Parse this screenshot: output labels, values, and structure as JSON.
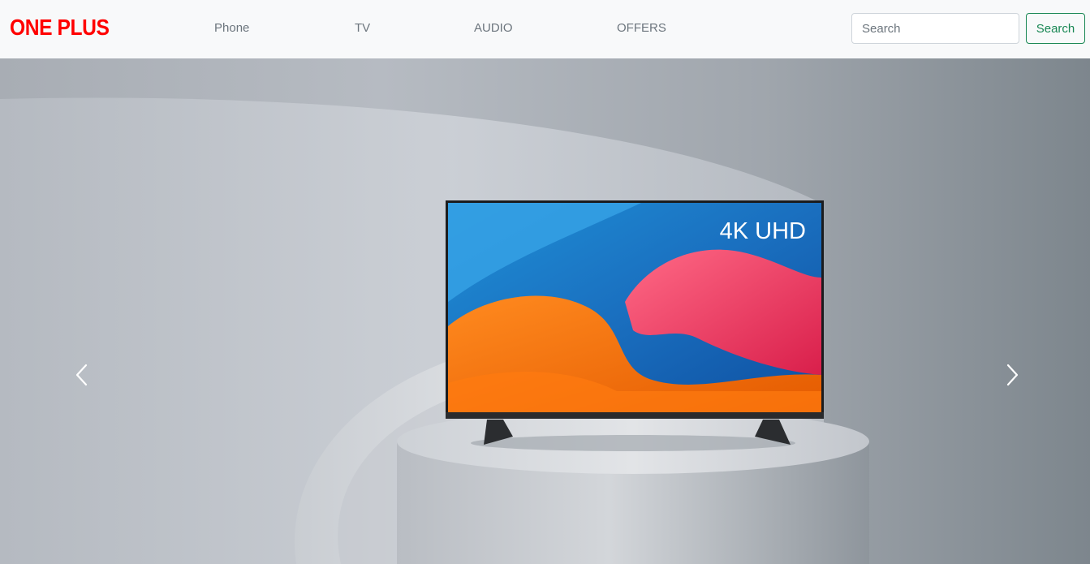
{
  "brand": {
    "name": "ONE PLUS",
    "color": "#ff0000"
  },
  "nav": {
    "items": [
      {
        "label": "Phone"
      },
      {
        "label": "TV"
      },
      {
        "label": "AUDIO"
      },
      {
        "label": "OFFERS"
      }
    ]
  },
  "search": {
    "placeholder": "Search",
    "value": "",
    "button_label": "Search",
    "button_color": "#198754"
  },
  "hero": {
    "screen_label": "4K UHD",
    "prev_icon": "chevron-left-icon",
    "next_icon": "chevron-right-icon"
  }
}
